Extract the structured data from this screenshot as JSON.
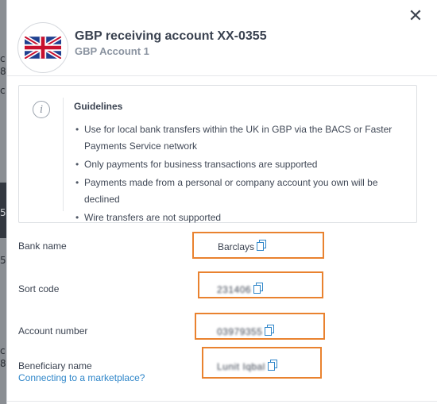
{
  "background_fragments": [
    "c",
    "8",
    "c",
    "5",
    "5",
    "c",
    "8"
  ],
  "modal": {
    "close_symbol": "✕",
    "flag": "uk-flag-icon",
    "account_title": "GBP receiving account XX-0355",
    "account_subtitle": "GBP Account 1"
  },
  "guidelines": {
    "icon": "info-icon",
    "title": "Guidelines",
    "items": [
      "Use for local bank transfers within the UK in GBP via the BACS or Faster Payments Service network",
      "Only payments for business transactions are supported",
      "Payments made from a personal or company account you own will be declined",
      "Wire transfers are not supported"
    ]
  },
  "fields": {
    "bank_name": {
      "label": "Bank name",
      "value": "Barclays"
    },
    "sort_code": {
      "label": "Sort code",
      "value": "231406"
    },
    "account_number": {
      "label": "Account number",
      "value": "03979355"
    },
    "beneficiary_name": {
      "label": "Beneficiary name",
      "value": "Lunit Iqbal"
    }
  },
  "marketplace_link": "Connecting to a marketplace?",
  "colors": {
    "highlight": "#e9822f",
    "link": "#2f86c9",
    "copy_icon": "#2f86c9"
  }
}
